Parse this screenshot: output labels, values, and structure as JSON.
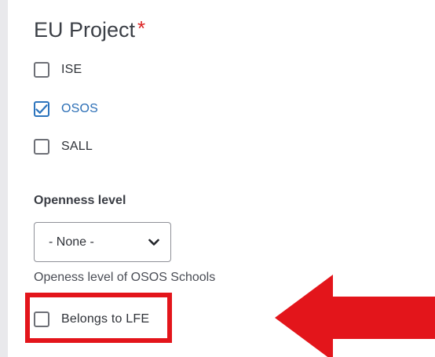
{
  "field": {
    "title": "EU Project",
    "required_mark": "*",
    "options": [
      {
        "label": "ISE",
        "checked": false
      },
      {
        "label": "OSOS",
        "checked": true
      },
      {
        "label": "SALL",
        "checked": false
      }
    ]
  },
  "openness": {
    "label": "Openness level",
    "selected": "- None -",
    "help": "Openess level of OSOS Schools"
  },
  "lfe": {
    "label": "Belongs to LFE",
    "checked": false
  },
  "colors": {
    "accent": "#2c74bd",
    "required": "#dc2323",
    "annotation": "#e3151b"
  },
  "icons": {
    "checkmark": "checkmark-icon",
    "dropdown": "chevron-down-icon",
    "annotation_arrow": "arrow-left-icon"
  }
}
